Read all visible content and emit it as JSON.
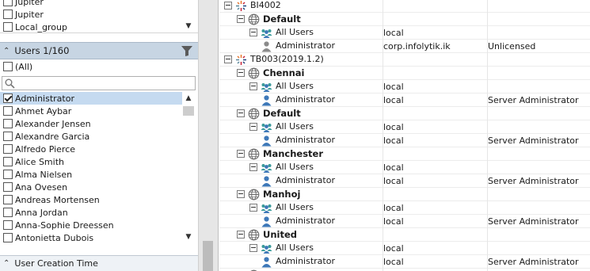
{
  "top_list": {
    "items": [
      "Jupiter",
      "Jupiter",
      "Local_group"
    ]
  },
  "users_section": {
    "title": "Users 1/160",
    "all_label": "(All)",
    "search_placeholder": "",
    "items": [
      {
        "label": "Administrator",
        "checked": true,
        "selected": true
      },
      {
        "label": "Ahmet Aybar",
        "checked": false
      },
      {
        "label": "Alexander Jensen",
        "checked": false
      },
      {
        "label": "Alexandre Garcia",
        "checked": false
      },
      {
        "label": "Alfredo Pierce",
        "checked": false
      },
      {
        "label": "Alice Smith",
        "checked": false
      },
      {
        "label": "Alma Nielsen",
        "checked": false
      },
      {
        "label": "Ana Ovesen",
        "checked": false
      },
      {
        "label": "Andreas Mortensen",
        "checked": false
      },
      {
        "label": "Anna Jordan",
        "checked": false
      },
      {
        "label": "Anna-Sophie Dreessen",
        "checked": false
      },
      {
        "label": "Antonietta Dubois",
        "checked": false
      }
    ]
  },
  "creation_section": {
    "title": "User Creation Time"
  },
  "tree": {
    "rows": [
      {
        "level": 0,
        "type": "server",
        "label": "BI4002",
        "c2": "",
        "c3": ""
      },
      {
        "level": 1,
        "type": "site",
        "label": "Default",
        "c2": "",
        "c3": ""
      },
      {
        "level": 2,
        "type": "group",
        "label": "All Users",
        "c2": "local",
        "c3": ""
      },
      {
        "level": 3,
        "type": "user-gray",
        "label": "Administrator",
        "c2": "corp.infolytik.ik",
        "c3": "Unlicensed"
      },
      {
        "level": 0,
        "type": "server",
        "label": "TB003(2019.1.2)",
        "c2": "",
        "c3": ""
      },
      {
        "level": 1,
        "type": "site",
        "label": "Chennai",
        "c2": "",
        "c3": ""
      },
      {
        "level": 2,
        "type": "group",
        "label": "All Users",
        "c2": "local",
        "c3": ""
      },
      {
        "level": 3,
        "type": "user",
        "label": "Administrator",
        "c2": "local",
        "c3": "Server Administrator"
      },
      {
        "level": 1,
        "type": "site",
        "label": "Default",
        "c2": "",
        "c3": ""
      },
      {
        "level": 2,
        "type": "group",
        "label": "All Users",
        "c2": "local",
        "c3": ""
      },
      {
        "level": 3,
        "type": "user",
        "label": "Administrator",
        "c2": "local",
        "c3": "Server Administrator"
      },
      {
        "level": 1,
        "type": "site",
        "label": "Manchester",
        "c2": "",
        "c3": ""
      },
      {
        "level": 2,
        "type": "group",
        "label": "All Users",
        "c2": "local",
        "c3": ""
      },
      {
        "level": 3,
        "type": "user",
        "label": "Administrator",
        "c2": "local",
        "c3": "Server Administrator"
      },
      {
        "level": 1,
        "type": "site",
        "label": "Manhoj",
        "c2": "",
        "c3": ""
      },
      {
        "level": 2,
        "type": "group",
        "label": "All Users",
        "c2": "local",
        "c3": ""
      },
      {
        "level": 3,
        "type": "user",
        "label": "Administrator",
        "c2": "local",
        "c3": "Server Administrator"
      },
      {
        "level": 1,
        "type": "site",
        "label": "United",
        "c2": "",
        "c3": ""
      },
      {
        "level": 2,
        "type": "group",
        "label": "All Users",
        "c2": "local",
        "c3": ""
      },
      {
        "level": 3,
        "type": "user",
        "label": "Administrator",
        "c2": "local",
        "c3": "Server Administrator"
      },
      {
        "level": 1,
        "type": "site",
        "label": "",
        "c2": "",
        "c3": ""
      }
    ]
  },
  "colors": {
    "header_bg": "#c7d5e3",
    "selection_bg": "#c5daf0",
    "user_icon_blue": "#3d78b8",
    "user_icon_gray": "#8a8a8a",
    "group_icon_teal": "#3a9a9a"
  }
}
